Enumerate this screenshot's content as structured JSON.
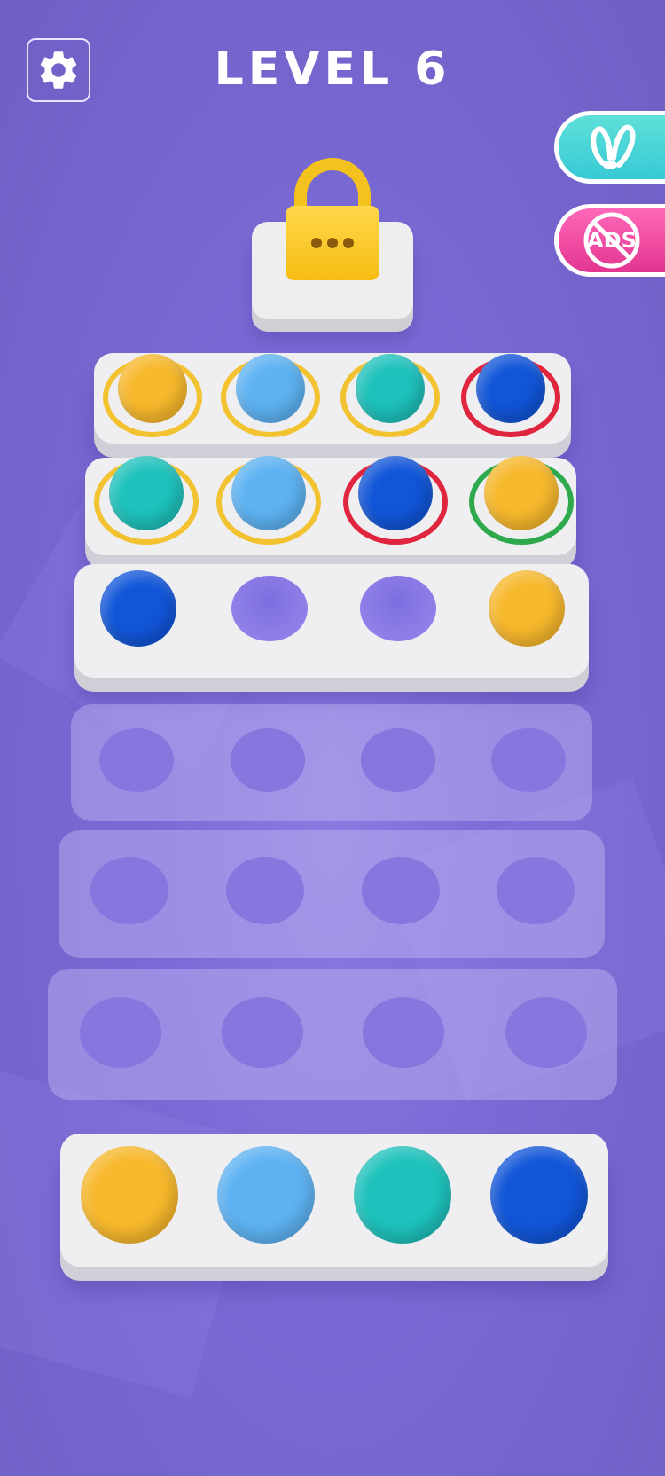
{
  "header": {
    "title": "LEVEL 6",
    "settings_icon": "gear-icon"
  },
  "side_buttons": {
    "hint_icon": "bunny-ears-icon",
    "no_ads_label": "ADS",
    "no_ads_icon": "no-ads-icon"
  },
  "lock": {
    "icon": "padlock-icon",
    "state": "locked"
  },
  "colors": {
    "yellow": "#F7B82C",
    "lightblue": "#5DB2F2",
    "teal": "#1EC1BC",
    "blue": "#1155D8",
    "ring_yellow": "#F2C230",
    "ring_red": "#E0263E",
    "ring_green": "#2EA94C"
  },
  "board": {
    "rows": [
      {
        "type": "filled",
        "slots": [
          {
            "ball": "yellow",
            "ring": "ring_yellow"
          },
          {
            "ball": "lightblue",
            "ring": "ring_yellow"
          },
          {
            "ball": "teal",
            "ring": "ring_yellow"
          },
          {
            "ball": "blue",
            "ring": "ring_red"
          }
        ]
      },
      {
        "type": "filled",
        "slots": [
          {
            "ball": "teal",
            "ring": "ring_yellow"
          },
          {
            "ball": "lightblue",
            "ring": "ring_yellow"
          },
          {
            "ball": "blue",
            "ring": "ring_red"
          },
          {
            "ball": "yellow",
            "ring": "ring_green"
          }
        ]
      },
      {
        "type": "filled",
        "slots": [
          {
            "ball": "blue",
            "ring": null
          },
          {
            "ball": null,
            "ring": null
          },
          {
            "ball": null,
            "ring": null
          },
          {
            "ball": "yellow",
            "ring": null
          }
        ]
      },
      {
        "type": "ghost",
        "slots": [
          {},
          {},
          {},
          {}
        ]
      },
      {
        "type": "ghost",
        "slots": [
          {},
          {},
          {},
          {}
        ]
      },
      {
        "type": "ghost",
        "slots": [
          {},
          {},
          {},
          {}
        ]
      }
    ],
    "target_row": [
      "yellow",
      "lightblue",
      "teal",
      "blue"
    ]
  }
}
